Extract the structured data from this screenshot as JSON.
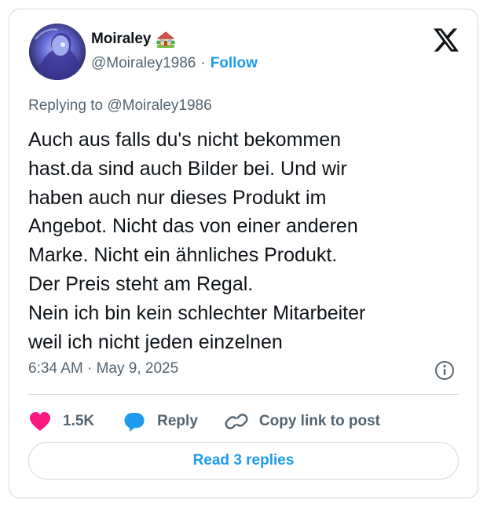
{
  "author": {
    "display_name": "Moiraley",
    "name_emoji_icon": "house-with-garden-icon",
    "handle": "@Moiraley1986",
    "separator": "·",
    "follow_label": "Follow"
  },
  "replying_to": "Replying to @Moiraley1986",
  "tweet": {
    "text": "Auch aus falls du's nicht bekommen\nhast.da sind auch Bilder bei. Und wir\nhaben auch nur dieses Produkt im\nAngebot. Nicht das von einer anderen\nMarke. Nicht ein ähnliches Produkt.\nDer Preis steht am Regal.\nNein ich bin kein schlechter Mitarbeiter\nweil ich nicht jeden einzelnen",
    "timestamp": "6:34 AM · May 9, 2025"
  },
  "actions": {
    "like_count": "1.5K",
    "reply_label": "Reply",
    "copy_link_label": "Copy link to post"
  },
  "read_replies_label": "Read 3 replies",
  "colors": {
    "accent": "#1d9bf0",
    "like": "#f91880",
    "secondary_text": "#536471",
    "border": "#cfd9de"
  }
}
